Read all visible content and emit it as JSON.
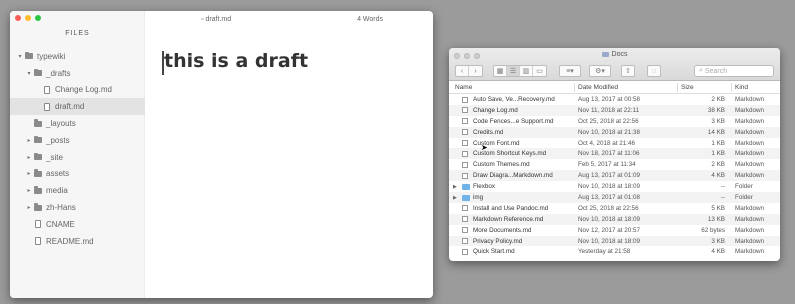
{
  "editor": {
    "sidebar_title": "FILES",
    "doc_title": "draft.md",
    "word_count": "4 Words",
    "heading": "this is a draft",
    "tree": [
      {
        "label": "typewiki",
        "type": "folder",
        "depth": 0,
        "arrow": "▾",
        "selected": false
      },
      {
        "label": "_drafts",
        "type": "folder",
        "depth": 1,
        "arrow": "▾",
        "selected": false
      },
      {
        "label": "Change Log.md",
        "type": "file",
        "depth": 2,
        "arrow": "",
        "selected": false
      },
      {
        "label": "draft.md",
        "type": "file",
        "depth": 2,
        "arrow": "",
        "selected": true
      },
      {
        "label": "_layouts",
        "type": "folder",
        "depth": 1,
        "arrow": "",
        "selected": false
      },
      {
        "label": "_posts",
        "type": "folder",
        "depth": 1,
        "arrow": "▸",
        "selected": false
      },
      {
        "label": "_site",
        "type": "folder",
        "depth": 1,
        "arrow": "▸",
        "selected": false
      },
      {
        "label": "assets",
        "type": "folder",
        "depth": 1,
        "arrow": "▸",
        "selected": false
      },
      {
        "label": "media",
        "type": "folder",
        "depth": 1,
        "arrow": "▸",
        "selected": false
      },
      {
        "label": "zh-Hans",
        "type": "folder",
        "depth": 1,
        "arrow": "▸",
        "selected": false
      },
      {
        "label": "CNAME",
        "type": "file",
        "depth": 1,
        "arrow": "",
        "selected": false
      },
      {
        "label": "README.md",
        "type": "file",
        "depth": 1,
        "arrow": "",
        "selected": false
      }
    ]
  },
  "finder": {
    "title": "Docs",
    "search_placeholder": "Search",
    "columns": {
      "name": "Name",
      "date": "Date Modified",
      "size": "Size",
      "kind": "Kind"
    },
    "rows": [
      {
        "name": "Auto Save, Ve...Recovery.md",
        "date": "Aug 13, 2017 at 00:58",
        "size": "2 KB",
        "kind": "Markdown",
        "type": "md"
      },
      {
        "name": "Change Log.md",
        "date": "Nov 11, 2018 at 22:11",
        "size": "38 KB",
        "kind": "Markdown",
        "type": "md"
      },
      {
        "name": "Code Fences...e Support.md",
        "date": "Oct 25, 2018 at 22:56",
        "size": "3 KB",
        "kind": "Markdown",
        "type": "md"
      },
      {
        "name": "Credits.md",
        "date": "Nov 10, 2018 at 21:38",
        "size": "14 KB",
        "kind": "Markdown",
        "type": "md"
      },
      {
        "name": "Custom Font.md",
        "date": "Oct 4, 2018 at 21:46",
        "size": "1 KB",
        "kind": "Markdown",
        "type": "md"
      },
      {
        "name": "Custom Shortcut Keys.md",
        "date": "Nov 18, 2017 at 11:06",
        "size": "1 KB",
        "kind": "Markdown",
        "type": "md"
      },
      {
        "name": "Custom Themes.md",
        "date": "Feb 5, 2017 at 11:34",
        "size": "2 KB",
        "kind": "Markdown",
        "type": "md"
      },
      {
        "name": "Draw Diagra...Markdown.md",
        "date": "Aug 13, 2017 at 01:09",
        "size": "4 KB",
        "kind": "Markdown",
        "type": "md"
      },
      {
        "name": "Flexbox",
        "date": "Nov 10, 2018 at 18:09",
        "size": "--",
        "kind": "Folder",
        "type": "folder"
      },
      {
        "name": "img",
        "date": "Aug 13, 2017 at 01:08",
        "size": "--",
        "kind": "Folder",
        "type": "folder"
      },
      {
        "name": "Install and Use Pandoc.md",
        "date": "Oct 25, 2018 at 22:56",
        "size": "5 KB",
        "kind": "Markdown",
        "type": "md"
      },
      {
        "name": "Markdown Reference.md",
        "date": "Nov 10, 2018 at 18:09",
        "size": "13 KB",
        "kind": "Markdown",
        "type": "md"
      },
      {
        "name": "More Documents.md",
        "date": "Nov 12, 2017 at 20:57",
        "size": "62 bytes",
        "kind": "Markdown",
        "type": "md"
      },
      {
        "name": "Privacy Policy.md",
        "date": "Nov 10, 2018 at 18:09",
        "size": "3 KB",
        "kind": "Markdown",
        "type": "md"
      },
      {
        "name": "Quick Start.md",
        "date": "Yesterday at 21:58",
        "size": "4 KB",
        "kind": "Markdown",
        "type": "md"
      }
    ]
  }
}
